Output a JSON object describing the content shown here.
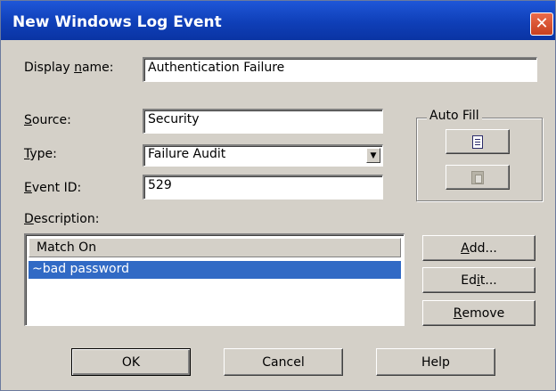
{
  "window": {
    "title": "New Windows Log Event",
    "close_glyph": "✕"
  },
  "display_name": {
    "label_pre": "Display ",
    "label_key": "n",
    "label_post": "ame:",
    "value": "Authentication Failure"
  },
  "source": {
    "label_key": "S",
    "label_post": "ource:",
    "value": "Security"
  },
  "type": {
    "label_key": "T",
    "label_post": "ype:",
    "value": "Failure Audit",
    "arrow": "▼"
  },
  "event_id": {
    "label_key": "E",
    "label_post": "vent ID:",
    "value": "529"
  },
  "auto_fill": {
    "title": "Auto Fill",
    "copy_icon": "document-icon",
    "paste_icon": "clipboard-icon"
  },
  "description": {
    "label_key": "D",
    "label_post": "escription:",
    "column_header": "Match On",
    "rows": [
      "~bad password"
    ]
  },
  "buttons": {
    "add": {
      "key": "A",
      "post": "dd..."
    },
    "edit": {
      "pre": "Ed",
      "key": "i",
      "post": "t..."
    },
    "remove": {
      "key": "R",
      "post": "emove"
    },
    "ok": "OK",
    "cancel": "Cancel",
    "help": "Help"
  },
  "colors": {
    "titlebar": "#0f3fb8",
    "selection": "#316ac5",
    "face": "#d4d0c8",
    "close": "#d5502e"
  }
}
